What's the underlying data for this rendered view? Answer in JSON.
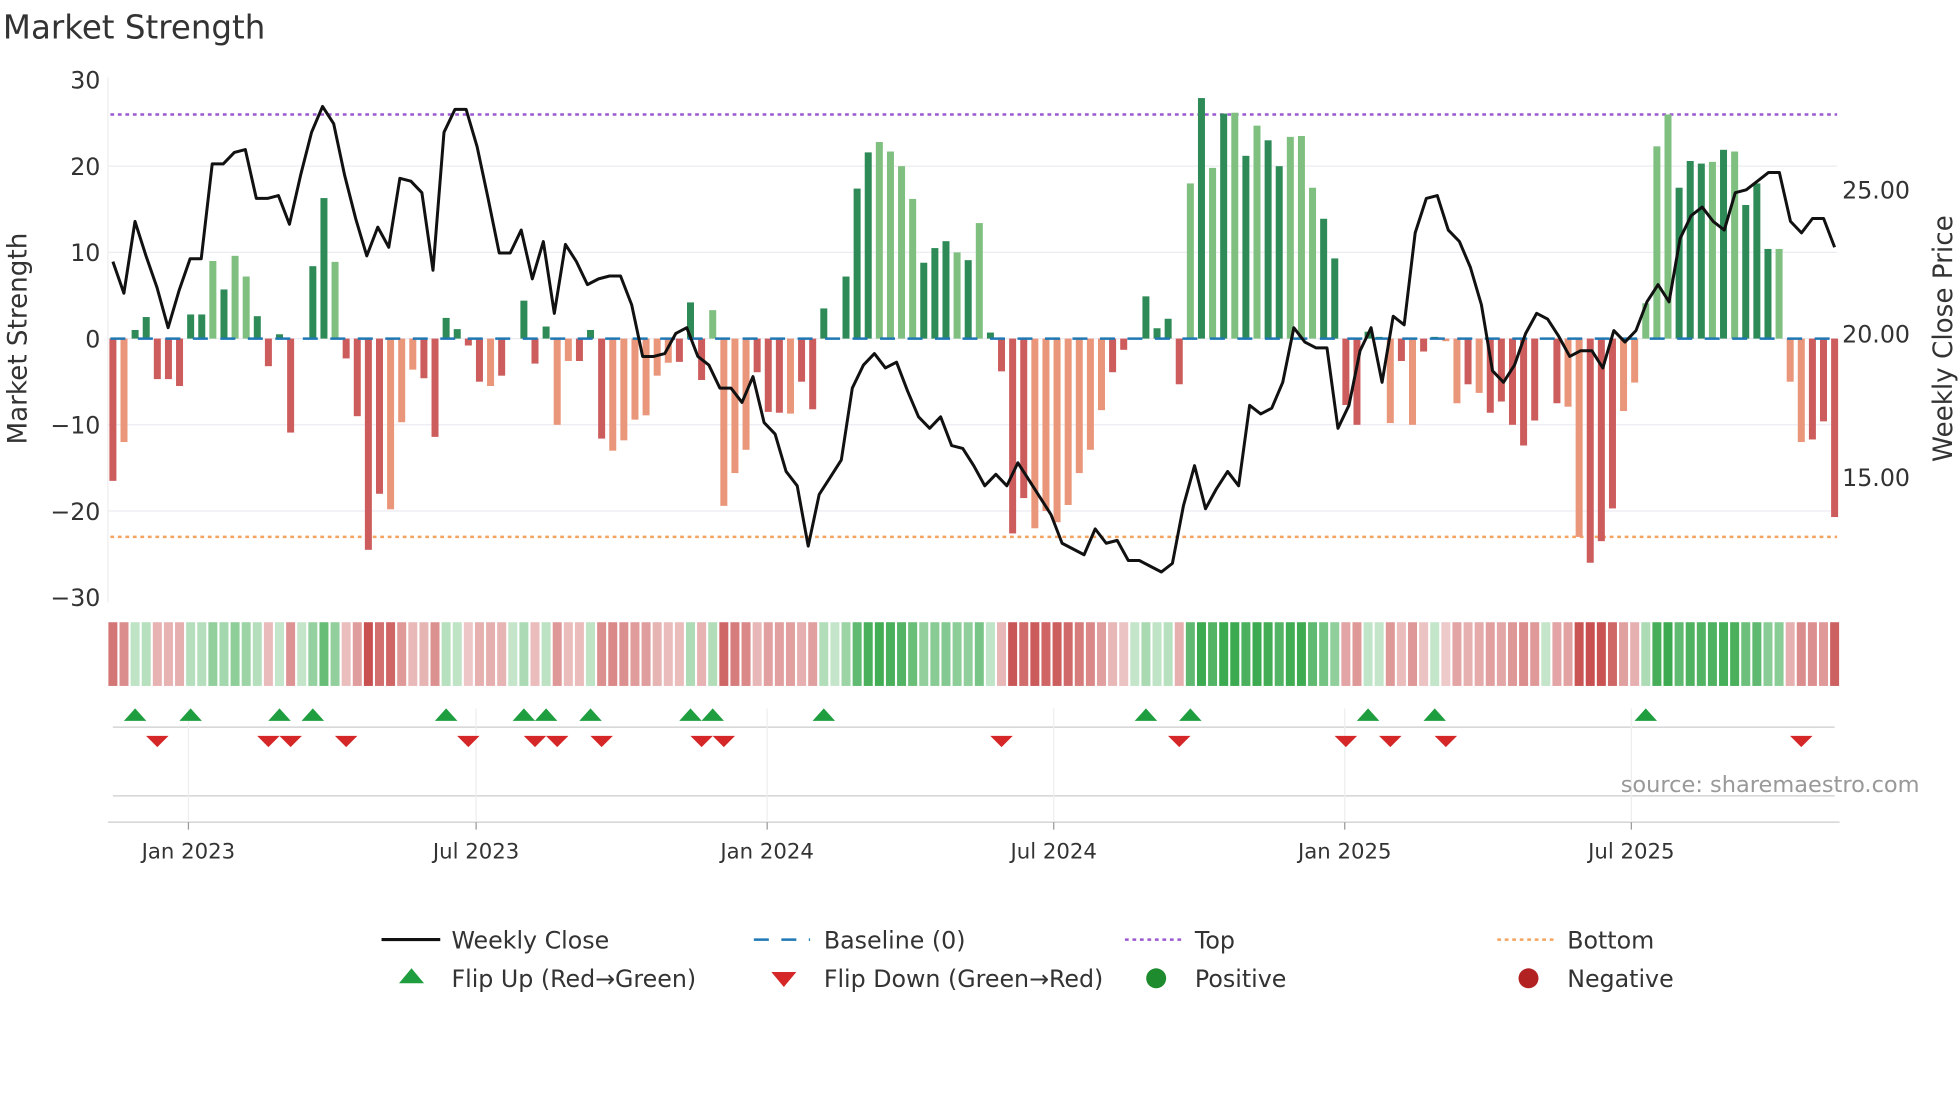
{
  "chart_data": {
    "type": "bar",
    "title": "Market Strength",
    "ylabel": "Market Strength",
    "y2label": "Weekly Close Price",
    "ylim": [
      -30,
      30
    ],
    "y2lim": [
      10.78,
      28.78
    ],
    "yticks": [
      "30",
      "20",
      "10",
      "0",
      "−10",
      "−20",
      "−30"
    ],
    "ytick_values": [
      30,
      20,
      10,
      0,
      -10,
      -20,
      -30
    ],
    "y2ticks": [
      "25.00",
      "20.00",
      "15.00"
    ],
    "y2tick_values": [
      25,
      20,
      15
    ],
    "xticks": [
      {
        "label": "Jan 2023",
        "week": 6.8
      },
      {
        "label": "Jul 2023",
        "week": 32.7
      },
      {
        "label": "Jan 2024",
        "week": 58.9
      },
      {
        "label": "Jul 2024",
        "week": 84.7
      },
      {
        "label": "Jan 2025",
        "week": 110.9
      },
      {
        "label": "Jul 2025",
        "week": 136.7
      }
    ],
    "top_level": 26,
    "bottom_level": -23,
    "grid": true,
    "strength": [
      -16.5,
      -12,
      1,
      2.5,
      -4.7,
      -4.7,
      -5.5,
      2.8,
      2.8,
      9,
      5.7,
      9.6,
      7.2,
      2.6,
      -3.2,
      0.5,
      -10.9,
      0,
      8.4,
      16.3,
      8.9,
      -2.3,
      -9,
      -24.5,
      -18,
      -19.8,
      -9.7,
      -3.6,
      -4.6,
      -11.4,
      2.4,
      1.1,
      -0.8,
      -5,
      -5.5,
      -4.3,
      0,
      4.4,
      -2.9,
      1.4,
      -10,
      -2.6,
      -2.6,
      1,
      -11.6,
      -13,
      -11.8,
      -9.4,
      -8.9,
      -4.3,
      -2.8,
      -2.7,
      4.2,
      -4.8,
      3.3,
      -19.4,
      -15.6,
      -12.9,
      -3.9,
      -8.5,
      -8.6,
      -8.7,
      -5,
      -8.2,
      3.5,
      0,
      7.2,
      17.4,
      21.6,
      22.8,
      21.7,
      20,
      16.2,
      8.8,
      10.5,
      11.3,
      10,
      9.1,
      13.4,
      0.7,
      -3.8,
      -22.6,
      -18.5,
      -22,
      -20,
      -21.3,
      -19.3,
      -15.6,
      -12.9,
      -8.3,
      -3.9,
      -1.3,
      0,
      4.9,
      1.2,
      2.3,
      -5.3,
      18,
      27.9,
      19.8,
      26.1,
      26.2,
      21.2,
      24.7,
      23,
      20,
      23.4,
      23.5,
      17.5,
      13.9,
      9.3,
      -7.7,
      -10,
      0.8,
      0.2,
      -9.8,
      -2.6,
      -10,
      -1.5,
      0.2,
      -0.3,
      -7.5,
      -5.3,
      -6.3,
      -8.6,
      -7.3,
      -10,
      -12.4,
      -9.5,
      0,
      -7.5,
      -7.9,
      -23,
      -26,
      -23.5,
      -19.7,
      -8.4,
      -5.1,
      4.1,
      22.3,
      26,
      17.5,
      20.6,
      20.3,
      20.5,
      21.9,
      21.7,
      15.5,
      18,
      10.4,
      10.4,
      -5,
      -12,
      -11.7,
      -9.6,
      -20.7
    ],
    "tone": "dldddddddldlldddddddlddddlllddddddldddddlldddlllllldddlllldddldddddddlllldddldlddddlllllllddlddddldldldlddlllddddddldlddlldldddddddlldddllllldddldldddlllddddlldld",
    "weekly_close": [
      22.5,
      21.4,
      23.9,
      22.7,
      21.6,
      20.2,
      21.5,
      22.6,
      22.6,
      25.9,
      25.9,
      26.3,
      26.4,
      24.7,
      24.7,
      24.8,
      23.8,
      25.5,
      27,
      27.9,
      27.3,
      25.5,
      24,
      22.7,
      23.7,
      23,
      25.4,
      25.3,
      24.9,
      22.2,
      27,
      27.8,
      27.8,
      26.5,
      24.7,
      22.8,
      22.8,
      23.6,
      21.9,
      23.2,
      20.7,
      23.1,
      22.5,
      21.7,
      21.9,
      22,
      22,
      21,
      19.2,
      19.2,
      19.3,
      20,
      20.2,
      19.2,
      18.9,
      18.1,
      18.1,
      17.6,
      18.5,
      16.9,
      16.5,
      15.2,
      14.7,
      12.6,
      14.4,
      15,
      15.6,
      18.1,
      18.9,
      19.3,
      18.8,
      19,
      18,
      17.1,
      16.7,
      17.1,
      16.1,
      16,
      15.4,
      14.7,
      15.1,
      14.7,
      15.5,
      14.9,
      14.3,
      13.7,
      12.7,
      12.5,
      12.3,
      13.2,
      12.7,
      12.8,
      12.1,
      12.1,
      11.9,
      11.7,
      12,
      14,
      15.4,
      13.9,
      14.6,
      15.2,
      14.7,
      17.5,
      17.2,
      17.4,
      18.3,
      20.2,
      19.7,
      19.5,
      19.5,
      16.7,
      17.5,
      19.4,
      20.2,
      18.3,
      20.6,
      20.3,
      23.5,
      24.7,
      24.8,
      23.6,
      23.2,
      22.3,
      21,
      18.7,
      18.3,
      18.9,
      20,
      20.7,
      20.5,
      19.9,
      19.2,
      19.4,
      19.4,
      18.8,
      20.1,
      19.7,
      20.1,
      21.1,
      21.7,
      21.1,
      23.3,
      24.1,
      24.4,
      23.9,
      23.6,
      24.9,
      25,
      25.3,
      25.6,
      25.6,
      23.9,
      23.5,
      24,
      24,
      23
    ],
    "flip_up_weeks": [
      2,
      7,
      15,
      18,
      30,
      37,
      39,
      43,
      52,
      54,
      64,
      93,
      97,
      113,
      119,
      138
    ],
    "flip_down_weeks": [
      4,
      14,
      16,
      21,
      32,
      38,
      40,
      44,
      53,
      55,
      80,
      96,
      111,
      115,
      120,
      152
    ],
    "legend": [
      {
        "label": "Weekly Close",
        "kind": "line"
      },
      {
        "label": "Baseline (0)",
        "kind": "dash"
      },
      {
        "label": "Top",
        "kind": "dot-top"
      },
      {
        "label": "Bottom",
        "kind": "dot-bottom"
      },
      {
        "label": "Flip Up (Red→Green)",
        "kind": "tri-up"
      },
      {
        "label": "Flip Down (Green→Red)",
        "kind": "tri-down"
      },
      {
        "label": "Positive",
        "kind": "circle-pos"
      },
      {
        "label": "Negative",
        "kind": "circle-neg"
      }
    ],
    "legend_placement": "bottom",
    "source": "source: sharemaestro.com",
    "colors": {
      "pos_strong": "#2e8b57",
      "pos_weak": "#7fbf7f",
      "neg_strong": "#cd5c5c",
      "neg_weak": "#e9967a",
      "line": "#111111",
      "baseline": "#1f77b4",
      "top": "#9b59d0",
      "bottom": "#f4a460",
      "flip_up": "#1e9e3e",
      "flip_down": "#d62728",
      "positive": "#1e8c2e",
      "negative": "#b22222"
    }
  }
}
